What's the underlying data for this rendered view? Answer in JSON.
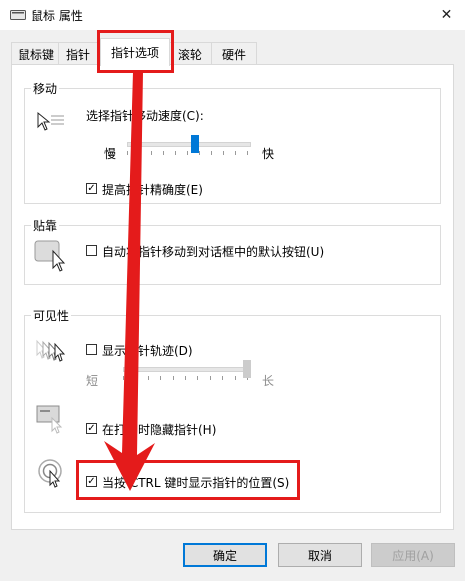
{
  "window": {
    "title": "鼠标 属性",
    "close_glyph": "✕"
  },
  "tabs": [
    {
      "label": "鼠标键",
      "active": false
    },
    {
      "label": "指针",
      "active": false
    },
    {
      "label": "指针选项",
      "active": true
    },
    {
      "label": "滚轮",
      "active": false
    },
    {
      "label": "硬件",
      "active": false
    }
  ],
  "motion": {
    "title": "移动",
    "speed_label": "选择指针移动速度(C):",
    "slow_label": "慢",
    "fast_label": "快",
    "speed_value": 0.55,
    "precision_label": "提高指针精确度(E)",
    "precision_checked": true
  },
  "snap": {
    "title": "贴靠",
    "snap_label": "自动将指针移动到对话框中的默认按钮(U)",
    "snap_checked": false
  },
  "visibility": {
    "title": "可见性",
    "trails_label": "显示指针轨迹(D)",
    "trails_checked": false,
    "short_label": "短",
    "long_label": "长",
    "trail_length": 1.0,
    "hide_label": "在打字时隐藏指针(H)",
    "hide_checked": true,
    "ctrl_label": "当按 CTRL 键时显示指针的位置(S)",
    "ctrl_checked": true
  },
  "buttons": {
    "ok": "确定",
    "cancel": "取消",
    "apply": "应用(A)"
  },
  "colors": {
    "accent": "#0078d7",
    "highlight": "#e41b1b"
  }
}
